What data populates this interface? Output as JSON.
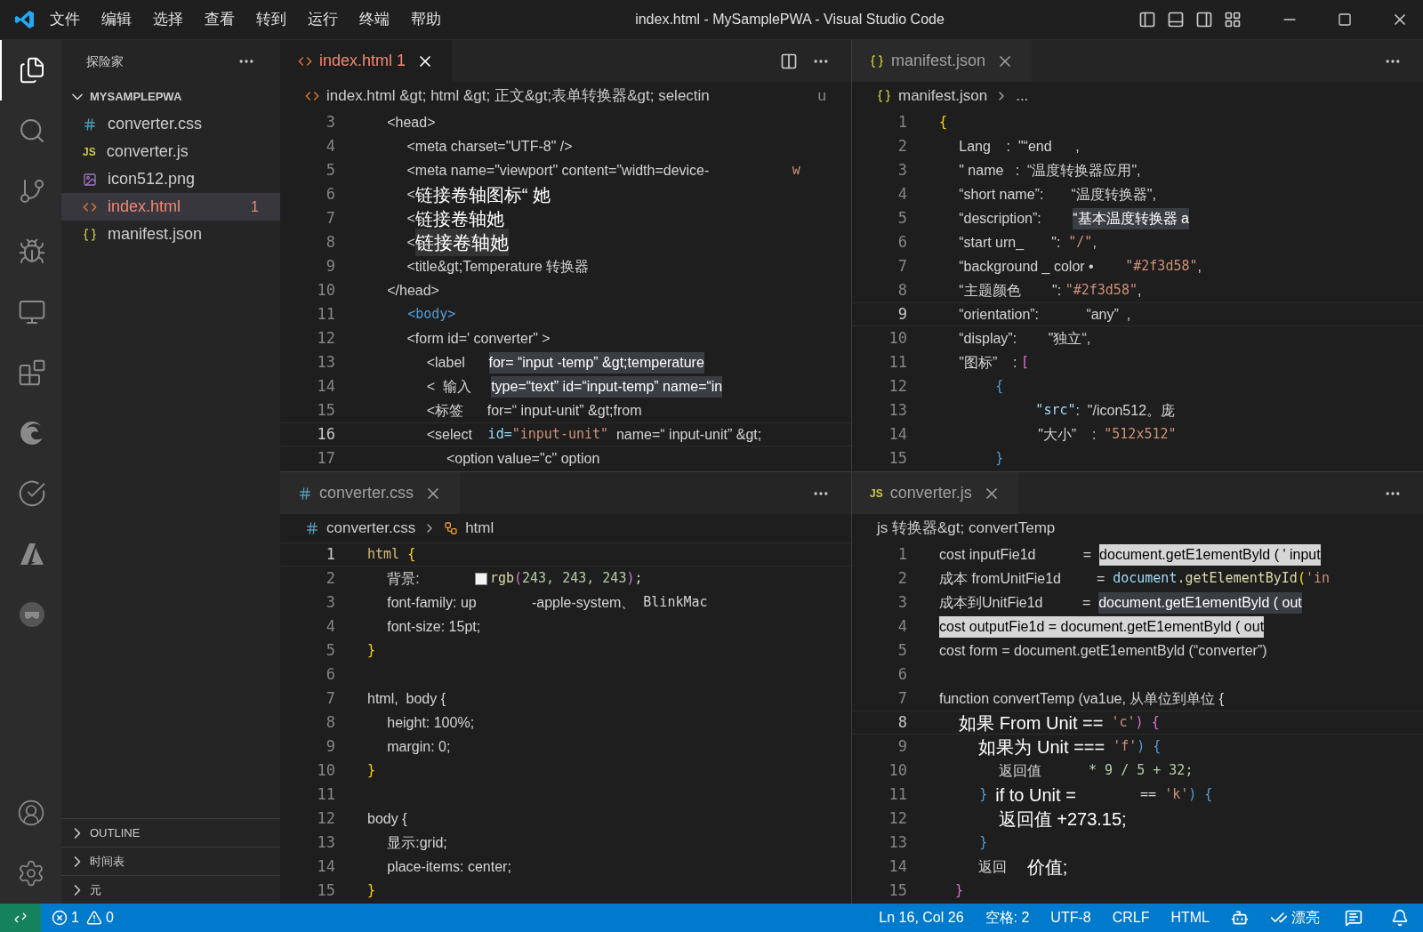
{
  "title_bar": {
    "menus": [
      "文件",
      "编辑",
      "选择",
      "查看",
      "转到",
      "运行",
      "终端",
      "帮助"
    ],
    "title": "index.html - MySamplePWA - Visual Studio Code"
  },
  "activity_bar": {
    "top": [
      {
        "kind": "explorer",
        "selected": true
      },
      {
        "kind": "search",
        "selected": false
      },
      {
        "kind": "source-control",
        "selected": false
      },
      {
        "kind": "debug",
        "selected": false
      },
      {
        "kind": "remote",
        "selected": false
      },
      {
        "kind": "extensions",
        "selected": false
      },
      {
        "kind": "edge",
        "selected": false
      },
      {
        "kind": "testing",
        "selected": false
      },
      {
        "kind": "azure",
        "selected": false
      },
      {
        "kind": "docker",
        "selected": false
      }
    ],
    "bottom": [
      {
        "kind": "account"
      },
      {
        "kind": "settings"
      }
    ]
  },
  "sidebar": {
    "title": "探险家",
    "sections": [
      {
        "label": "MYSAMPLEPWA",
        "expanded": true,
        "items": [
          {
            "name": "converter.css",
            "kind": "css",
            "selected": false
          },
          {
            "name": "converter.js",
            "kind": "js",
            "glyph": "JS",
            "selected": false
          },
          {
            "name": "icon512.png",
            "kind": "image",
            "selected": false
          },
          {
            "name": "index.html",
            "kind": "html",
            "selected": true,
            "problems": "1"
          },
          {
            "name": "manifest.json",
            "kind": "json",
            "selected": false
          }
        ]
      },
      {
        "label": "OUTLINE",
        "expanded": false
      },
      {
        "label": "时间表",
        "expanded": false
      },
      {
        "label": "元",
        "expanded": false
      }
    ]
  },
  "editor_groups": [
    {
      "tab": {
        "label": "index.html",
        "kind": "html",
        "problems": "1",
        "selected": true
      },
      "split_action": true,
      "breadcrumb": {
        "items": [
          {
            "text": "index.html &gt; html &gt; 正文&gt;表单转换器&gt; selectin",
            "kind": "html"
          }
        ],
        "edge_text": "u"
      },
      "lines": [
        {
          "number": "3",
          "current": false,
          "segments": [
            {
              "text": "     <head>",
              "kind": "text"
            }
          ]
        },
        {
          "number": "4",
          "current": false,
          "segments": [
            {
              "text": "          <meta charset=\"UTF-8\" />",
              "kind": "text"
            }
          ]
        },
        {
          "number": "5",
          "current": false,
          "segments": [
            {
              "text": "          <meta name=\"viewport\" content=\"width=device-                     ",
              "kind": "text"
            },
            {
              "text": "w",
              "kind": "string"
            }
          ]
        },
        {
          "number": "6",
          "current": false,
          "segments": [
            {
              "text": "          <",
              "kind": "text"
            },
            {
              "text": "链接卷轴图标“ 她",
              "kind": "large"
            }
          ]
        },
        {
          "number": "7",
          "current": false,
          "segments": [
            {
              "text": "          <",
              "kind": "text"
            },
            {
              "text": "链接卷轴她",
              "kind": "large"
            }
          ]
        },
        {
          "number": "8",
          "current": false,
          "segments": [
            {
              "text": "          <",
              "kind": "text"
            },
            {
              "text": "链接卷轴她",
              "kind": "large-highlight"
            }
          ]
        },
        {
          "number": "9",
          "current": false,
          "segments": [
            {
              "text": "          <title&gt;Temperature 转换器",
              "kind": "text"
            }
          ]
        },
        {
          "number": "10",
          "current": false,
          "segments": [
            {
              "text": "     </head>",
              "kind": "text"
            }
          ]
        },
        {
          "number": "11",
          "current": false,
          "segments": [
            {
              "text": "     <body>",
              "kind": "tag"
            }
          ]
        },
        {
          "number": "12",
          "current": false,
          "segments": [
            {
              "text": "          <form id=' converter\" >",
              "kind": "text"
            }
          ]
        },
        {
          "number": "13",
          "current": false,
          "segments": [
            {
              "text": "               <label      ",
              "kind": "text"
            },
            {
              "text": "for= “input -temp” &gt;temperature",
              "kind": "highlight"
            }
          ]
        },
        {
          "number": "14",
          "current": false,
          "segments": [
            {
              "text": "               <  输入     ",
              "kind": "text"
            },
            {
              "text": "type=“text” id=“input-temp” name=“in",
              "kind": "highlight"
            }
          ]
        },
        {
          "number": "15",
          "current": false,
          "segments": [
            {
              "text": "               <标签      for=“ input-unit” &gt;from",
              "kind": "text"
            }
          ]
        },
        {
          "number": "16",
          "current": true,
          "segments": [
            {
              "text": "               <select    ",
              "kind": "text"
            },
            {
              "text": "id=",
              "kind": "property"
            },
            {
              "text": "\"input-unit\"",
              "kind": "string"
            },
            {
              "text": "  name=“ input-unit” &gt;",
              "kind": "text"
            }
          ]
        },
        {
          "number": "17",
          "current": false,
          "segments": [
            {
              "text": "                    <option value=\"c\" option",
              "kind": "text"
            }
          ]
        }
      ]
    },
    {
      "tab": {
        "label": "manifest.json",
        "kind": "json",
        "selected": false
      },
      "breadcrumb": {
        "items": [
          {
            "text": "manifest.json",
            "kind": "json"
          },
          {
            "text": "..."
          }
        ]
      },
      "lines": [
        {
          "number": "1",
          "current": false,
          "segments": [
            {
              "text": "{",
              "kind": "brace"
            }
          ]
        },
        {
          "number": "2",
          "current": false,
          "segments": [
            {
              "text": "     Lang    :  \"“end      ,",
              "kind": "text"
            }
          ]
        },
        {
          "number": "3",
          "current": false,
          "segments": [
            {
              "text": "     \" name   :  “温度转换器应用\",",
              "kind": "text"
            }
          ]
        },
        {
          "number": "4",
          "current": false,
          "segments": [
            {
              "text": "     “short name”:       “温度转换器\",",
              "kind": "text"
            }
          ]
        },
        {
          "number": "5",
          "current": false,
          "segments": [
            {
              "text": "     “description”:        ",
              "kind": "text"
            },
            {
              "text": "“基本温度转换器 a",
              "kind": "highlight"
            }
          ]
        },
        {
          "number": "6",
          "current": false,
          "segments": [
            {
              "text": "     “start urn_       \":  ",
              "kind": "text"
            },
            {
              "text": "\"/\"",
              "kind": "string"
            },
            {
              "text": ",",
              "kind": "text"
            }
          ]
        },
        {
          "number": "7",
          "current": false,
          "segments": [
            {
              "text": "     “background _ color •        ",
              "kind": "text"
            },
            {
              "text": "\"#2f3d58\"",
              "kind": "string"
            },
            {
              "text": ",",
              "kind": "text"
            }
          ]
        },
        {
          "number": "8",
          "current": false,
          "segments": [
            {
              "text": "     “主题颜色        \": ",
              "kind": "text"
            },
            {
              "text": "\"#2f3d58\"",
              "kind": "string"
            },
            {
              "text": ",",
              "kind": "text"
            }
          ]
        },
        {
          "number": "9",
          "current": true,
          "segments": [
            {
              "text": "     “orientation”:            “any”  ,",
              "kind": "text"
            }
          ]
        },
        {
          "number": "10",
          "current": false,
          "segments": [
            {
              "text": "     “display”:        \"独立“,",
              "kind": "text"
            }
          ]
        },
        {
          "number": "11",
          "current": false,
          "segments": [
            {
              "text": "     \"图标”    : ",
              "kind": "text"
            },
            {
              "text": "[",
              "kind": "bracket"
            }
          ]
        },
        {
          "number": "12",
          "current": false,
          "segments": [
            {
              "text": "       {",
              "kind": "tag"
            }
          ]
        },
        {
          "number": "13",
          "current": false,
          "segments": [
            {
              "text": "            \"src\"",
              "kind": "property"
            },
            {
              "text": ":  \"/icon512。庞",
              "kind": "text"
            }
          ]
        },
        {
          "number": "14",
          "current": false,
          "segments": [
            {
              "text": "                         \"大小”    :  ",
              "kind": "text"
            },
            {
              "text": "\"512x512\"",
              "kind": "string"
            }
          ]
        },
        {
          "number": "15",
          "current": false,
          "segments": [
            {
              "text": "       }",
              "kind": "tag"
            }
          ]
        }
      ]
    },
    {
      "tab": {
        "label": "converter.css",
        "kind": "css",
        "selected": false
      },
      "breadcrumb": {
        "items": [
          {
            "text": "converter.css",
            "kind": "css"
          },
          {
            "text": "html",
            "kind": "symbol"
          }
        ]
      },
      "lines": [
        {
          "number": "1",
          "current": true,
          "segments": [
            {
              "text": "html",
              "kind": "selector"
            },
            {
              "text": " {",
              "kind": "brace"
            }
          ]
        },
        {
          "number": "2",
          "current": false,
          "segments": [
            {
              "text": "     背景:              ",
              "kind": "text"
            },
            {
              "kind": "swatch"
            },
            {
              "text": "rgb",
              "kind": "func"
            },
            {
              "text": "(",
              "kind": "bracket"
            },
            {
              "text": "243, 243, 243",
              "kind": "number"
            },
            {
              "text": ")",
              "kind": "bracket"
            },
            {
              "text": ";",
              "kind": "mono"
            }
          ]
        },
        {
          "number": "3",
          "current": false,
          "segments": [
            {
              "text": "     font-family: up              -apple-system、  ",
              "kind": "text"
            },
            {
              "text": "BlinkMac",
              "kind": "mono"
            }
          ]
        },
        {
          "number": "4",
          "current": false,
          "segments": [
            {
              "text": "     font-size: 15pt;",
              "kind": "text"
            }
          ]
        },
        {
          "number": "5",
          "current": false,
          "segments": [
            {
              "text": "}",
              "kind": "brace"
            }
          ]
        },
        {
          "number": "6",
          "current": false
        },
        {
          "number": "7",
          "current": false,
          "segments": [
            {
              "text": "html,  body {",
              "kind": "text"
            }
          ]
        },
        {
          "number": "8",
          "current": false,
          "segments": [
            {
              "text": "     height: 100%;",
              "kind": "text"
            }
          ]
        },
        {
          "number": "9",
          "current": false,
          "segments": [
            {
              "text": "     margin: 0;",
              "kind": "text"
            }
          ]
        },
        {
          "number": "10",
          "current": false,
          "segments": [
            {
              "text": "}",
              "kind": "brace"
            }
          ]
        },
        {
          "number": "11",
          "current": false
        },
        {
          "number": "12",
          "current": false,
          "segments": [
            {
              "text": "body {",
              "kind": "text"
            }
          ]
        },
        {
          "number": "13",
          "current": false,
          "segments": [
            {
              "text": "     显示:grid;",
              "kind": "text"
            }
          ]
        },
        {
          "number": "14",
          "current": false,
          "segments": [
            {
              "text": "     place-items: center;",
              "kind": "text"
            }
          ]
        },
        {
          "number": "15",
          "current": false,
          "segments": [
            {
              "text": "}",
              "kind": "brace"
            }
          ]
        }
      ]
    },
    {
      "tab": {
        "label": "converter.js",
        "kind": "js",
        "glyph": "JS",
        "selected": false
      },
      "breadcrumb": {
        "items": [
          {
            "text": "js 转换器&gt; convertTemp"
          }
        ]
      },
      "lines": [
        {
          "number": "1",
          "current": false,
          "segments": [
            {
              "text": "cost inputFie1d            =  ",
              "kind": "text"
            },
            {
              "text": "document.getE1ementByld ( ' input",
              "kind": "selected"
            }
          ]
        },
        {
          "number": "2",
          "current": false,
          "segments": [
            {
              "text": "成本 fromUnitFie1d         =  ",
              "kind": "text"
            },
            {
              "text": "document",
              "kind": "property"
            },
            {
              "text": ".",
              "kind": "mono"
            },
            {
              "text": "getElementById",
              "kind": "func"
            },
            {
              "text": "(",
              "kind": "brace"
            },
            {
              "text": "'in",
              "kind": "string"
            }
          ]
        },
        {
          "number": "3",
          "current": false,
          "segments": [
            {
              "text": "成本到UnitFie1d          =  ",
              "kind": "text"
            },
            {
              "text": "document.getE1ementByld ( out",
              "kind": "highlight"
            }
          ]
        },
        {
          "number": "4",
          "current": false,
          "segments": [
            {
              "text": "cost outputFie1d = document.getE1ementByld ( out",
              "kind": "selected"
            }
          ]
        },
        {
          "number": "5",
          "current": false,
          "segments": [
            {
              "text": "cost form = document.getE1ementByld (“converter”)",
              "kind": "text"
            }
          ]
        },
        {
          "number": "6",
          "current": false
        },
        {
          "number": "7",
          "current": false,
          "segments": [
            {
              "text": "function convertTemp (va1ue, 从单位到单位 {",
              "kind": "text"
            }
          ]
        },
        {
          "number": "8",
          "current": true,
          "segments": [
            {
              "text": "    如果 From Unit ==",
              "kind": "large"
            },
            {
              "text": " 'c'",
              "kind": "string"
            },
            {
              "text": ") {",
              "kind": "bracket"
            }
          ]
        },
        {
          "number": "9",
          "current": false,
          "segments": [
            {
              "text": "        如果为 Unit ===",
              "kind": "large"
            },
            {
              "text": " 'f'",
              "kind": "string"
            },
            {
              "text": ") {",
              "kind": "tag"
            }
          ]
        },
        {
          "number": "10",
          "current": false,
          "segments": [
            {
              "text": "               返回值            ",
              "kind": "text"
            },
            {
              "text": "* 9 / 5 + 32;",
              "kind": "number"
            }
          ]
        },
        {
          "number": "11",
          "current": false,
          "segments": [
            {
              "text": "     } ",
              "kind": "tag"
            },
            {
              "text": "if to Unit =",
              "kind": "large"
            },
            {
              "text": "        == ",
              "kind": "mono"
            },
            {
              "text": "'k'",
              "kind": "string"
            },
            {
              "text": ") {",
              "kind": "tag"
            }
          ]
        },
        {
          "number": "12",
          "current": false,
          "segments": [
            {
              "text": "            返回值 +273.15;",
              "kind": "large"
            }
          ]
        },
        {
          "number": "13",
          "current": false,
          "segments": [
            {
              "text": "     }",
              "kind": "tag"
            }
          ]
        },
        {
          "number": "14",
          "current": false,
          "segments": [
            {
              "text": "          返回     ",
              "kind": "text"
            },
            {
              "text": "价值;",
              "kind": "large"
            }
          ]
        },
        {
          "number": "15",
          "current": false,
          "segments": [
            {
              "text": "  }",
              "kind": "bracket"
            }
          ]
        }
      ]
    }
  ],
  "status_bar": {
    "left": [
      {
        "kind": "remote"
      },
      {
        "kind": "problems",
        "errors": "1",
        "warnings": "0"
      }
    ],
    "right": [
      {
        "kind": "text",
        "text": "Ln 16, Col 26"
      },
      {
        "kind": "text",
        "text": "空格: 2"
      },
      {
        "kind": "text",
        "text": "UTF-8"
      },
      {
        "kind": "text",
        "text": "CRLF"
      },
      {
        "kind": "text",
        "text": "HTML"
      },
      {
        "kind": "copilot"
      },
      {
        "kind": "prettier",
        "text": "漂亮"
      },
      {
        "kind": "feedback"
      },
      {
        "kind": "bell"
      }
    ]
  }
}
